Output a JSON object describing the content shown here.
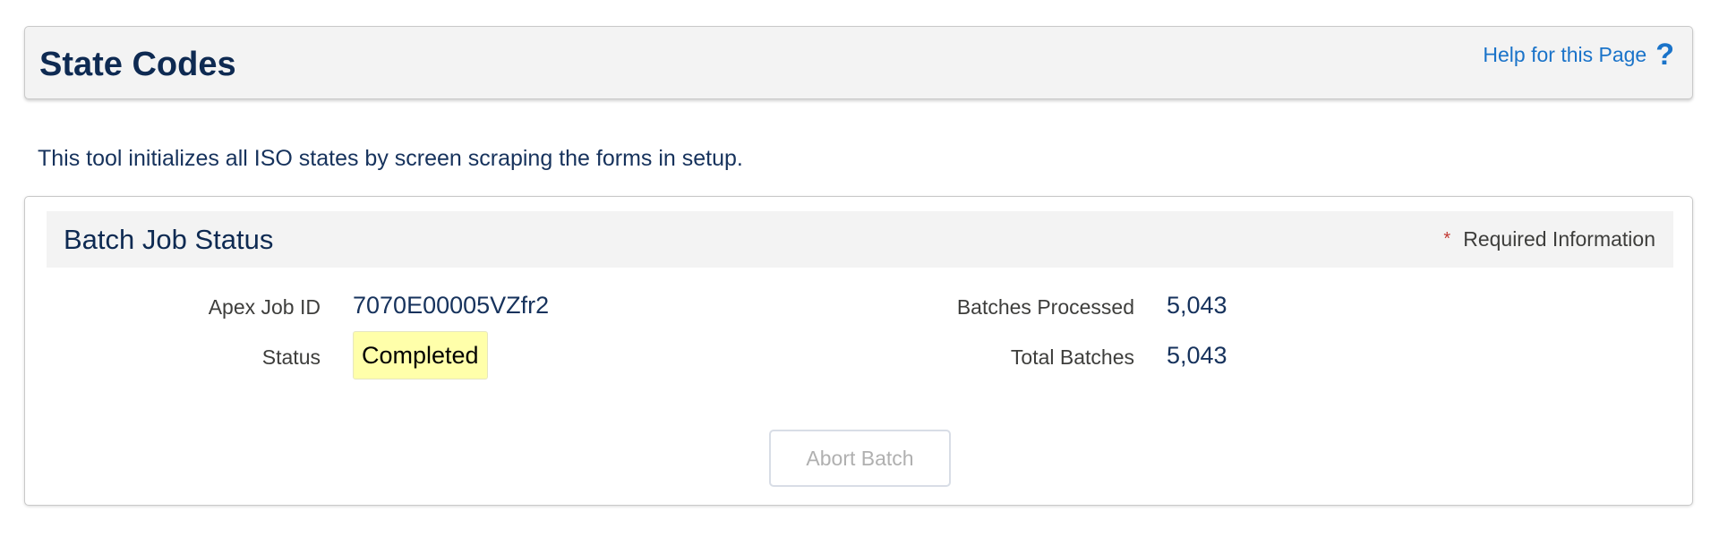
{
  "header": {
    "title": "State Codes",
    "help_link": "Help for this Page",
    "help_icon": "help-question-icon"
  },
  "description": "This tool initializes all ISO states by screen scraping the forms in setup.",
  "batch_job": {
    "title": "Batch Job Status",
    "required_marker": "*",
    "required_label": "Required Information",
    "fields": {
      "apex_job_id_label": "Apex Job ID",
      "apex_job_id_value": "7070E00005VZfr2",
      "status_label": "Status",
      "status_value": "Completed",
      "batches_processed_label": "Batches Processed",
      "batches_processed_value": "5,043",
      "total_batches_label": "Total Batches",
      "total_batches_value": "5,043"
    },
    "abort_button_label": "Abort Batch"
  },
  "colors": {
    "title": "#0e2a52",
    "link": "#1a73c9",
    "status_highlight": "#ffffaa",
    "required_star": "#c23934"
  }
}
